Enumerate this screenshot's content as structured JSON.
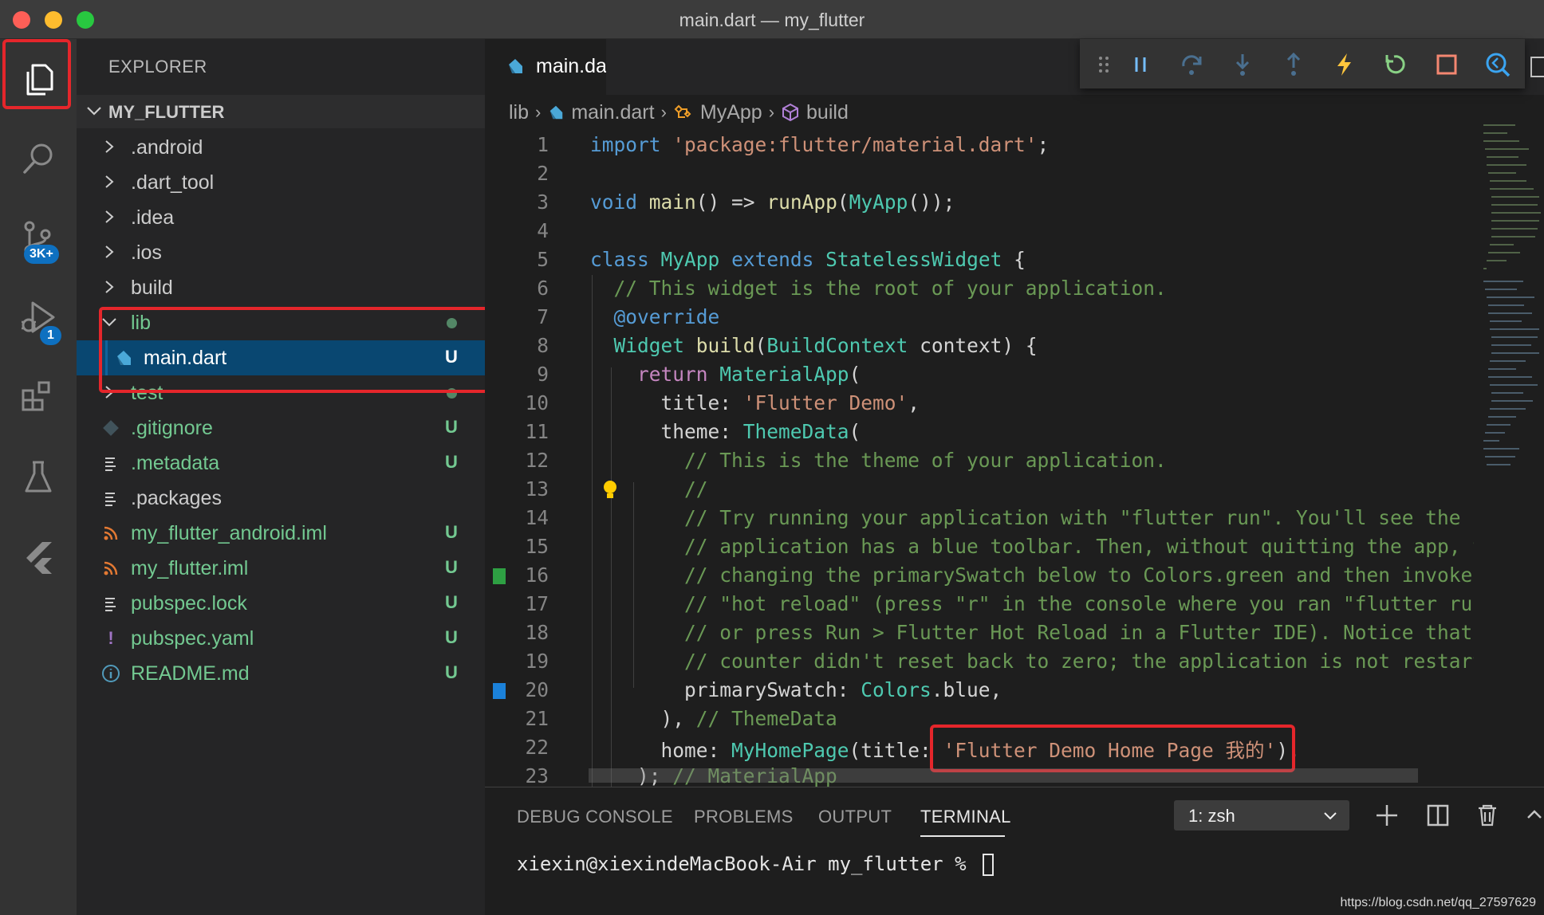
{
  "window": {
    "title": "main.dart — my_flutter"
  },
  "activity_bar": {
    "source_control_badge": "3K+",
    "debug_badge": "1"
  },
  "sidebar": {
    "title": "EXPLORER",
    "section": "MY_FLUTTER",
    "items": [
      {
        "name": ".android",
        "status": ""
      },
      {
        "name": ".dart_tool",
        "status": ""
      },
      {
        "name": ".idea",
        "status": ""
      },
      {
        "name": ".ios",
        "status": ""
      },
      {
        "name": "build",
        "status": ""
      },
      {
        "name": "lib",
        "status": ""
      },
      {
        "name": "main.dart",
        "status": "U"
      },
      {
        "name": "test",
        "status": ""
      },
      {
        "name": ".gitignore",
        "status": "U"
      },
      {
        "name": ".metadata",
        "status": "U"
      },
      {
        "name": ".packages",
        "status": ""
      },
      {
        "name": "my_flutter_android.iml",
        "status": "U"
      },
      {
        "name": "my_flutter.iml",
        "status": "U"
      },
      {
        "name": "pubspec.lock",
        "status": "U"
      },
      {
        "name": "pubspec.yaml",
        "status": "U"
      },
      {
        "name": "README.md",
        "status": "U"
      }
    ]
  },
  "editor": {
    "tab_label": "main.dart",
    "breadcrumb": [
      "lib",
      "main.dart",
      "MyApp",
      "build"
    ],
    "lines": [
      {
        "num": "1",
        "tokens": [
          [
            "kw",
            "import"
          ],
          [
            "white",
            " "
          ],
          [
            "str",
            "'package:flutter/material.dart'"
          ],
          [
            "white",
            ";"
          ]
        ]
      },
      {
        "num": "2",
        "tokens": []
      },
      {
        "num": "3",
        "tokens": [
          [
            "kw",
            "void"
          ],
          [
            "white",
            " "
          ],
          [
            "fn",
            "main"
          ],
          [
            "white",
            "() => "
          ],
          [
            "fn",
            "runApp"
          ],
          [
            "white",
            "("
          ],
          [
            "typ",
            "MyApp"
          ],
          [
            "white",
            "());"
          ]
        ]
      },
      {
        "num": "4",
        "tokens": []
      },
      {
        "num": "5",
        "tokens": [
          [
            "kw",
            "class"
          ],
          [
            "white",
            " "
          ],
          [
            "typ",
            "MyApp"
          ],
          [
            "white",
            " "
          ],
          [
            "kw",
            "extends"
          ],
          [
            "white",
            " "
          ],
          [
            "typ",
            "StatelessWidget"
          ],
          [
            "white",
            " {"
          ]
        ]
      },
      {
        "num": "6",
        "tokens": [
          [
            "white",
            "  "
          ],
          [
            "cmt",
            "// This widget is the root of your application."
          ]
        ]
      },
      {
        "num": "7",
        "tokens": [
          [
            "white",
            "  "
          ],
          [
            "kw",
            "@override"
          ]
        ]
      },
      {
        "num": "8",
        "tokens": [
          [
            "white",
            "  "
          ],
          [
            "typ",
            "Widget"
          ],
          [
            "white",
            " "
          ],
          [
            "fn",
            "build"
          ],
          [
            "white",
            "("
          ],
          [
            "typ",
            "BuildContext"
          ],
          [
            "white",
            " context) {"
          ]
        ]
      },
      {
        "num": "9",
        "tokens": [
          [
            "white",
            "    "
          ],
          [
            "kwc",
            "return"
          ],
          [
            "white",
            " "
          ],
          [
            "typ",
            "MaterialApp"
          ],
          [
            "white",
            "("
          ]
        ]
      },
      {
        "num": "10",
        "tokens": [
          [
            "white",
            "      title: "
          ],
          [
            "str",
            "'Flutter Demo'"
          ],
          [
            "white",
            ","
          ]
        ]
      },
      {
        "num": "11",
        "tokens": [
          [
            "white",
            "      theme: "
          ],
          [
            "typ",
            "ThemeData"
          ],
          [
            "white",
            "("
          ]
        ]
      },
      {
        "num": "12",
        "tokens": [
          [
            "white",
            "        "
          ],
          [
            "cmt",
            "// This is the theme of your application."
          ]
        ]
      },
      {
        "num": "13",
        "tokens": [
          [
            "white",
            "        "
          ],
          [
            "cmt",
            "//"
          ]
        ]
      },
      {
        "num": "14",
        "tokens": [
          [
            "white",
            "        "
          ],
          [
            "cmt",
            "// Try running your application with \"flutter run\". You'll see the"
          ]
        ]
      },
      {
        "num": "15",
        "tokens": [
          [
            "white",
            "        "
          ],
          [
            "cmt",
            "// application has a blue toolbar. Then, without quitting the app, tr"
          ]
        ]
      },
      {
        "num": "16",
        "tokens": [
          [
            "white",
            "        "
          ],
          [
            "cmt",
            "// changing the primarySwatch below to Colors.green and then invoke"
          ]
        ]
      },
      {
        "num": "17",
        "tokens": [
          [
            "white",
            "        "
          ],
          [
            "cmt",
            "// \"hot reload\" (press \"r\" in the console where you ran \"flutter run\""
          ]
        ]
      },
      {
        "num": "18",
        "tokens": [
          [
            "white",
            "        "
          ],
          [
            "cmt",
            "// or press Run > Flutter Hot Reload in a Flutter IDE). Notice that t"
          ]
        ]
      },
      {
        "num": "19",
        "tokens": [
          [
            "white",
            "        "
          ],
          [
            "cmt",
            "// counter didn't reset back to zero; the application is not restarte"
          ]
        ]
      },
      {
        "num": "20",
        "tokens": [
          [
            "white",
            "        primarySwatch: "
          ],
          [
            "typ",
            "Colors"
          ],
          [
            "white",
            ".blue,"
          ]
        ]
      },
      {
        "num": "21",
        "tokens": [
          [
            "white",
            "      ), "
          ],
          [
            "cmt",
            "// ThemeData"
          ]
        ]
      },
      {
        "num": "22",
        "tokens": [
          [
            "white",
            "      home: "
          ],
          [
            "typ",
            "MyHomePage"
          ],
          [
            "white",
            "(title: "
          ],
          [
            "str",
            "'Flutter Demo Home Page 我的'"
          ],
          [
            "white",
            "),"
          ]
        ]
      },
      {
        "num": "23",
        "tokens": [
          [
            "white",
            "    ); "
          ],
          [
            "cmt",
            "// MaterialApp"
          ]
        ]
      }
    ]
  },
  "panel": {
    "tabs": [
      "DEBUG CONSOLE",
      "PROBLEMS",
      "OUTPUT",
      "TERMINAL"
    ],
    "active_tab": "TERMINAL",
    "terminal_select": "1: zsh",
    "terminal_prompt": "xiexin@xiexindeMacBook-Air my_flutter % "
  },
  "watermark": "https://blog.csdn.net/qq_27597629",
  "colors": {
    "highlight_box": "#e5262b",
    "git_untracked": "#73c991",
    "selection": "#094771",
    "gutter_added": "#2ea043",
    "gutter_modified": "#1b81d9"
  }
}
